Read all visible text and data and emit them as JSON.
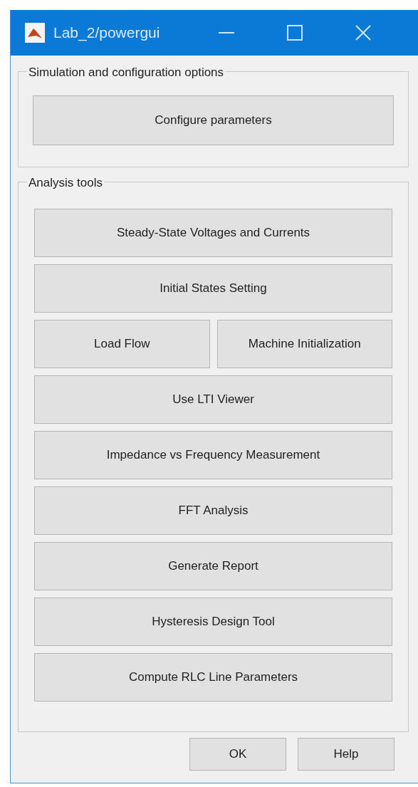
{
  "window": {
    "title": "Lab_2/powergui",
    "controls": [
      {
        "kind": "minimize"
      },
      {
        "kind": "maximize"
      },
      {
        "kind": "close"
      }
    ]
  },
  "simulation_group": {
    "title": "Simulation and configuration options",
    "buttons": [
      "Configure parameters"
    ]
  },
  "analysis_group": {
    "title": "Analysis tools",
    "rows": [
      {
        "buttons": [
          "Steady-State Voltages and Currents"
        ]
      },
      {
        "buttons": [
          "Initial States Setting"
        ]
      },
      {
        "buttons": [
          "Load Flow",
          "Machine Initialization"
        ]
      },
      {
        "buttons": [
          "Use LTI Viewer"
        ]
      },
      {
        "buttons": [
          "Impedance vs Frequency Measurement"
        ]
      },
      {
        "buttons": [
          "FFT Analysis"
        ]
      },
      {
        "buttons": [
          "Generate Report"
        ]
      },
      {
        "buttons": [
          "Hysteresis Design Tool"
        ]
      },
      {
        "buttons": [
          "Compute RLC  Line Parameters"
        ]
      }
    ]
  },
  "footer_buttons": [
    "OK",
    "Help"
  ]
}
